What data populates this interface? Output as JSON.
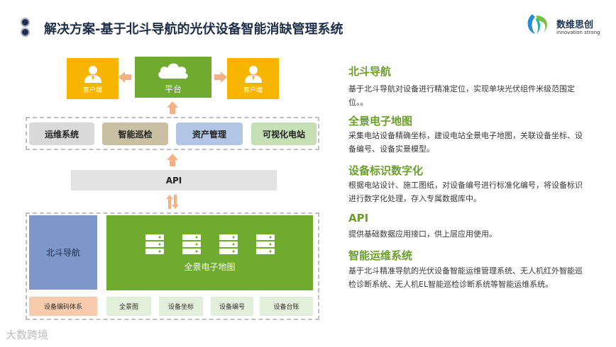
{
  "header": {
    "title": "解决方案-基于北斗导航的光伏设备智能消缺管理系统",
    "logo_name": "数维思创",
    "logo_tagline": "innovation strong"
  },
  "diagram": {
    "left_user": "客户端",
    "right_user": "客户端",
    "platform": "平台",
    "systems": [
      {
        "label": "运维系统",
        "color": "#d9d9d9"
      },
      {
        "label": "智能巡检",
        "color": "#c9c0a3"
      },
      {
        "label": "资产管理",
        "color": "#b4c6e7"
      },
      {
        "label": "可视化电站",
        "color": "#c5e0b4"
      }
    ],
    "api": "API",
    "beidou": "北斗导航",
    "panorama_map": "全景电子地图",
    "bottom_items": [
      "设备编码体系",
      "全景图",
      "设备坐标",
      "设备编号",
      "设备台账"
    ]
  },
  "features": [
    {
      "title": "北斗导航",
      "body": "基于北斗导航对设备进行精准定位，实现单块光伏组件米级范围定位。。"
    },
    {
      "title": "全景电子地图",
      "body": "采集电站设备精确坐标，建设电站全景电子地图，关联设备坐标、设备编号、设备实景模型。"
    },
    {
      "title": "设备标识数字化",
      "body": "根据电站设计、施工图纸，对设备编号进行标准化编号，将设备标识进行数字化处理，存入专属数据库中。"
    },
    {
      "title": "API",
      "body": "提供基础数据应用接口，供上层应用使用。"
    },
    {
      "title": "智能运维系统",
      "body": "基于北斗精准导航的光伏设备智能运维管理系统、无人机红外智能巡检诊断系统、无人机EL智能巡检诊断系统等智能运维系统。"
    }
  ],
  "watermark": "大数跨境",
  "colors": {
    "accent_green": "#6fab2f",
    "accent_yellow": "#f7b500",
    "arrow_orange": "#f4b183",
    "title_navy": "#1e2d4a"
  }
}
